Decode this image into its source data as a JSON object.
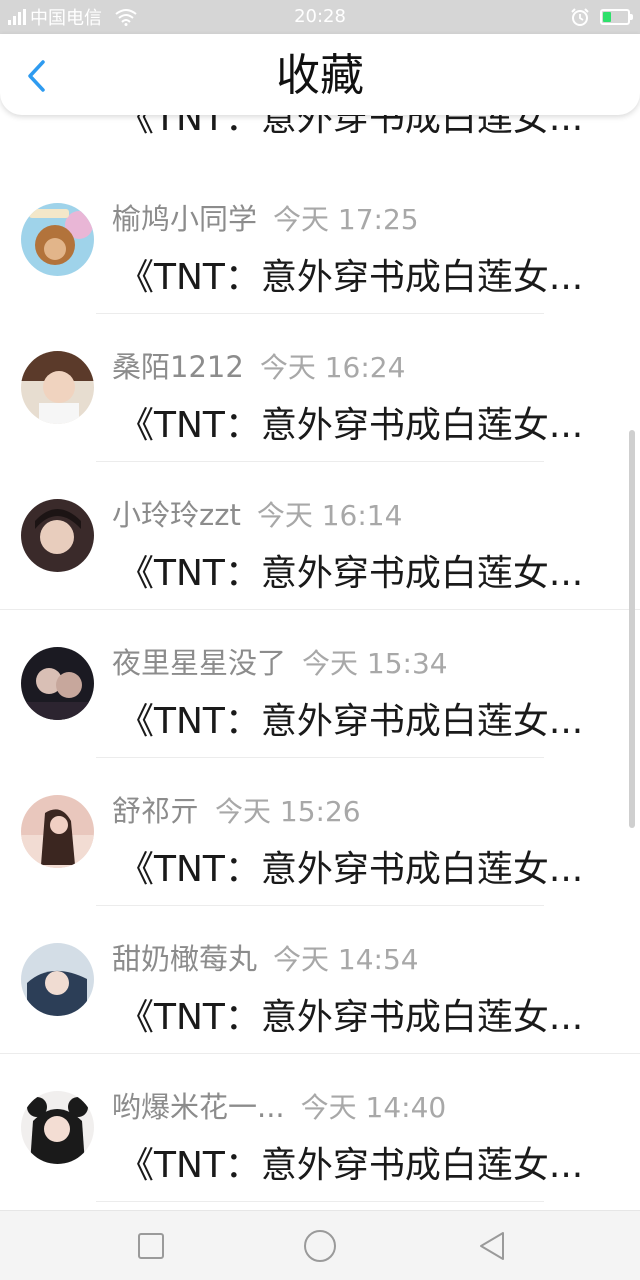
{
  "status_bar": {
    "carrier": "中国电信",
    "time": "20:28",
    "battery_color": "#2ee06b"
  },
  "header": {
    "title": "收藏",
    "back_icon": "chevron-left-icon",
    "accent_color": "#2e9bf0"
  },
  "favorites": [
    {
      "author": "",
      "time": "",
      "title": "《TNT：意外穿书成白莲女..."
    },
    {
      "author": "榆鸠小同学",
      "time": "今天 17:25",
      "title": "《TNT：意外穿书成白莲女..."
    },
    {
      "author": "桑陌1212",
      "time": "今天 16:24",
      "title": "《TNT：意外穿书成白莲女..."
    },
    {
      "author": "小玲玲zzt",
      "time": "今天 16:14",
      "title": "《TNT：意外穿书成白莲女..."
    },
    {
      "author": "夜里星星没了",
      "time": "今天 15:34",
      "title": "《TNT：意外穿书成白莲女..."
    },
    {
      "author": "舒祁亓",
      "time": "今天 15:26",
      "title": "《TNT：意外穿书成白莲女..."
    },
    {
      "author": "甜奶橄莓丸",
      "time": "今天 14:54",
      "title": "《TNT：意外穿书成白莲女..."
    },
    {
      "author": "哟爆米花一...",
      "time": "今天 14:40",
      "title": "《TNT：意外穿书成白莲女..."
    }
  ],
  "nav": {
    "square_icon": "recent-apps-square-icon",
    "circle_icon": "home-circle-icon",
    "triangle_icon": "back-triangle-icon"
  }
}
